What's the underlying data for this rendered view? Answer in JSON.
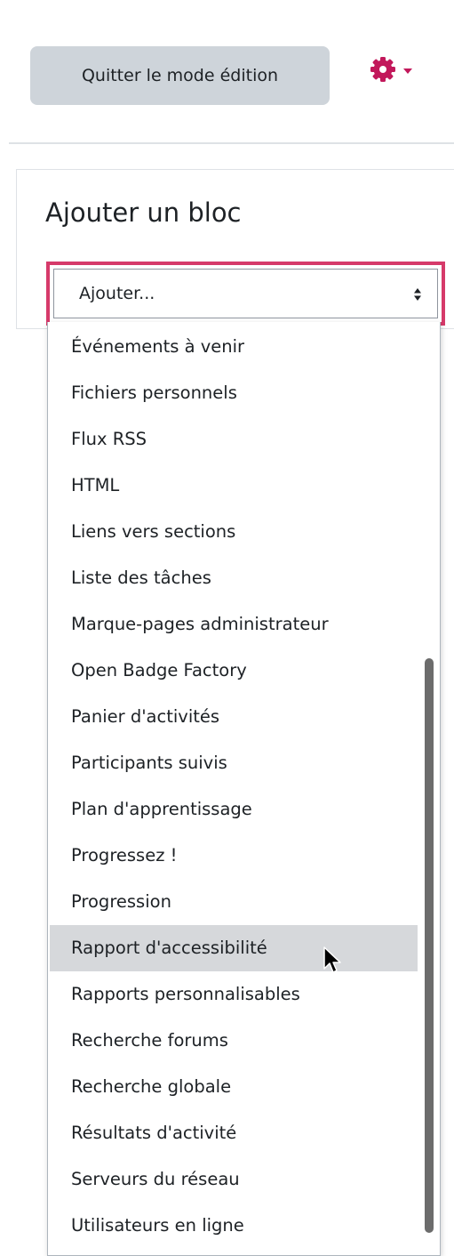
{
  "header": {
    "exit_edit_label": "Quitter le mode édition",
    "settings_icon": "gear-icon",
    "accent_color": "#c2185b"
  },
  "block": {
    "title": "Ajouter un bloc",
    "select": {
      "value": "Ajouter...",
      "focus_color": "#d63a6a",
      "options": [
        "Événements à venir",
        "Fichiers personnels",
        "Flux RSS",
        "HTML",
        "Liens vers sections",
        "Liste des tâches",
        "Marque-pages administrateur",
        "Open Badge Factory",
        "Panier d'activités",
        "Participants suivis",
        "Plan d'apprentissage",
        "Progressez !",
        "Progression",
        "Rapport d'accessibilité",
        "Rapports personnalisables",
        "Recherche forums",
        "Recherche globale",
        "Résultats d'activité",
        "Serveurs du réseau",
        "Utilisateurs en ligne"
      ],
      "hovered": "Rapport d'accessibilité"
    }
  }
}
